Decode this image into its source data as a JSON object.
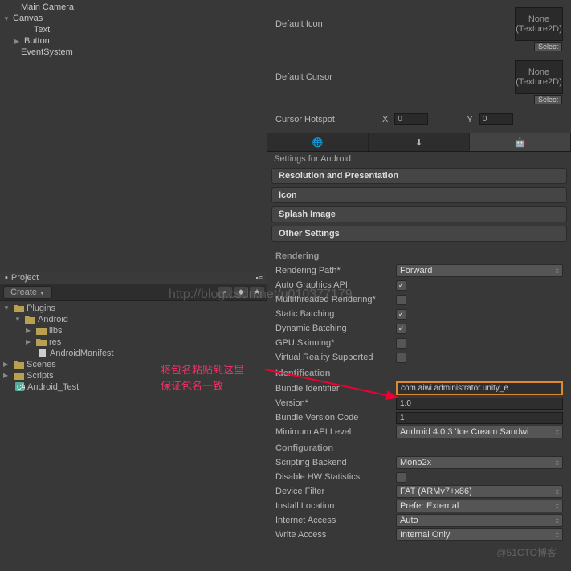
{
  "hierarchy": {
    "items": [
      {
        "name": "Main Camera",
        "indent": 1,
        "expand": ""
      },
      {
        "name": "Canvas",
        "indent": 0,
        "expand": "▼"
      },
      {
        "name": "Text",
        "indent": 2,
        "expand": ""
      },
      {
        "name": "Button",
        "indent": 1,
        "expand": "▶"
      },
      {
        "name": "EventSystem",
        "indent": 1,
        "expand": ""
      }
    ]
  },
  "project": {
    "tab": "Project",
    "create": "Create",
    "tree": [
      {
        "name": "Plugins",
        "indent": 0,
        "expand": "▼",
        "type": "folder"
      },
      {
        "name": "Android",
        "indent": 1,
        "expand": "▼",
        "type": "folder"
      },
      {
        "name": "libs",
        "indent": 2,
        "expand": "▶",
        "type": "folder"
      },
      {
        "name": "res",
        "indent": 2,
        "expand": "▶",
        "type": "folder"
      },
      {
        "name": "AndroidManifest",
        "indent": 3,
        "expand": "",
        "type": "file"
      },
      {
        "name": "Scenes",
        "indent": 0,
        "expand": "▶",
        "type": "folder"
      },
      {
        "name": "Scripts",
        "indent": 0,
        "expand": "▶",
        "type": "folder"
      },
      {
        "name": "Android_Test",
        "indent": 1,
        "expand": "",
        "type": "csharp"
      }
    ]
  },
  "inspector": {
    "default_icon": "Default Icon",
    "none": "None",
    "texture2d": "(Texture2D)",
    "select": "Select",
    "default_cursor": "Default Cursor",
    "cursor_hotspot": "Cursor Hotspot",
    "x": "X",
    "y": "Y",
    "hx": "0",
    "hy": "0"
  },
  "settings_title": "Settings for Android",
  "sections": {
    "resolution": "Resolution and Presentation",
    "icon": "Icon",
    "splash": "Splash Image",
    "other": "Other Settings"
  },
  "rendering": {
    "header": "Rendering",
    "path_label": "Rendering Path*",
    "path_value": "Forward",
    "auto_gfx": "Auto Graphics API",
    "multithread": "Multithreaded Rendering*",
    "static_batch": "Static Batching",
    "dynamic_batch": "Dynamic Batching",
    "gpu_skin": "GPU Skinning*",
    "vr": "Virtual Reality Supported"
  },
  "identification": {
    "header": "Identification",
    "bundle_id_label": "Bundle Identifier",
    "bundle_id_value": "com.aiwi.administrator.unity_e",
    "version_label": "Version*",
    "version_value": "1.0",
    "bvc_label": "Bundle Version Code",
    "bvc_value": "1",
    "min_api_label": "Minimum API Level",
    "min_api_value": "Android 4.0.3 'Ice Cream Sandwi"
  },
  "configuration": {
    "header": "Configuration",
    "backend_label": "Scripting Backend",
    "backend_value": "Mono2x",
    "disable_hw": "Disable HW Statistics",
    "device_filter_label": "Device Filter",
    "device_filter_value": "FAT (ARMv7+x86)",
    "install_loc_label": "Install Location",
    "install_loc_value": "Prefer External",
    "internet_label": "Internet Access",
    "internet_value": "Auto",
    "write_label": "Write Access",
    "write_value": "Internal Only"
  },
  "annotation": {
    "line1": "将包名粘贴到这里",
    "line2": "保证包名一致"
  },
  "watermark_url": "http://blog.csdn.net/u010377179",
  "watermark_site": "@51CTO博客"
}
